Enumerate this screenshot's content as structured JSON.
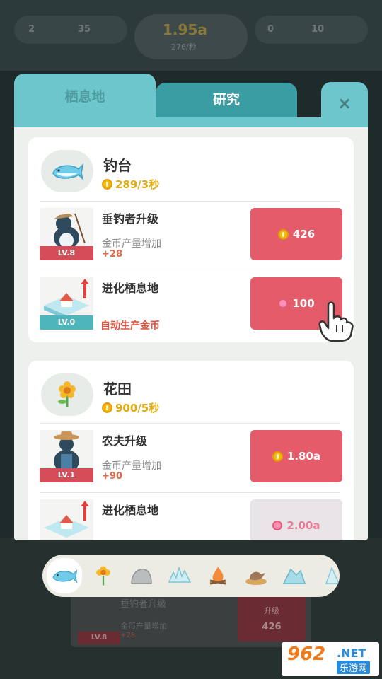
{
  "hud": {
    "left_val_1": "2",
    "left_val_2": "35",
    "gold_total": "1.95a",
    "gold_rate": "276/秒",
    "right_val_1": "0",
    "right_val_2": "10"
  },
  "tabs": {
    "habitat": "栖息地",
    "research": "研究",
    "close": "×"
  },
  "habitats": [
    {
      "name": "钓台",
      "rate": "289/3秒",
      "icon": "whale-icon",
      "rows": [
        {
          "title": "垂钓者升级",
          "desc": "金币产量增加",
          "value": "+28",
          "level": "LV.8",
          "price": "426",
          "currency": "coin",
          "disabled": false
        },
        {
          "title": "进化栖息地",
          "desc": "",
          "value": "自动生产金币",
          "level": "LV.0",
          "price": "100",
          "currency": "heart",
          "disabled": false
        }
      ]
    },
    {
      "name": "花田",
      "rate": "900/5秒",
      "icon": "flower-icon",
      "rows": [
        {
          "title": "农夫升级",
          "desc": "金币产量增加",
          "value": "+90",
          "level": "LV.1",
          "price": "1.80a",
          "currency": "coin",
          "disabled": false
        },
        {
          "title": "进化栖息地",
          "desc": "",
          "value": "",
          "level": "",
          "price": "2.00a",
          "currency": "heart",
          "disabled": true
        }
      ]
    }
  ],
  "selector": [
    "whale-icon",
    "flower-icon",
    "rock-icon",
    "ice-icon",
    "campfire-icon",
    "bird-nest-icon",
    "iceberg-icon",
    "ice-shard-icon"
  ],
  "background_card": {
    "title": "垂钓者升级",
    "desc": "金币产量增加",
    "value": "+28",
    "button": "升级",
    "price": "426",
    "level": "LV.8"
  },
  "watermark": {
    "num": "962",
    "net": ".NET",
    "cn": "乐游网"
  },
  "colors": {
    "accent_teal": "#6cc6cb",
    "button_red": "#e45b6a",
    "coin_gold": "#f3b90f"
  }
}
